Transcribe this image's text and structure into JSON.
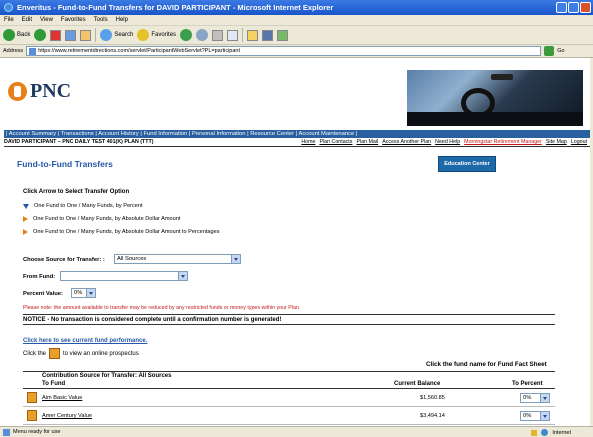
{
  "window": {
    "title": "Enveritus - Fund-to-Fund Transfers for DAVID PARTICIPANT - Microsoft Internet Explorer"
  },
  "menu": [
    "File",
    "Edit",
    "View",
    "Favorites",
    "Tools",
    "Help"
  ],
  "toolbar": {
    "back": "Back",
    "search": "Search",
    "favorites": "Favorites"
  },
  "address": {
    "label": "Address",
    "url": "https://www.retirementdirections.com/servlet/ParticipantWebServlet?PL=participant",
    "go": "Go"
  },
  "brand": {
    "name": "PNC"
  },
  "nav": {
    "text": "| Account Summary | Transactions | Account History | Fund Information | Personal Information | Resource Center | Account Maintenance |"
  },
  "subbar": {
    "user": "DAVID PARTICIPANT – PNC DAILY TEST 401(K) PLAN (TTT)",
    "links": [
      "Home",
      "Plan Contacts",
      "Plan Mail",
      "Access Another Plan",
      "Need Help",
      "Morningstar Retirement Manager",
      "Site Map",
      "Logout"
    ]
  },
  "main": {
    "title": "Fund-to-Fund Transfers",
    "education_button": "Education Center",
    "options_heading": "Click Arrow to Select Transfer Option",
    "options": [
      "One Fund to One / Many Funds, by Percent",
      "One Fund to One / Many Funds, by Absolute Dollar Amount",
      "One Fund to One / Many Funds, by Absolute Dollar Amount to Percentages"
    ],
    "source_label": "Choose Source for Transfer: :",
    "source_value": "All Sources",
    "from_fund_label": "From Fund:",
    "from_fund_value": "",
    "percent_label": "Percent Value:",
    "percent_value": "0%",
    "note": "Please note: the amount available to transfer may be reduced by any restricted funds or money types within your Plan.",
    "notice": "NOTICE - No transaction is considered complete until a confirmation number is generated!",
    "perf_link": "Click here to see current fund performance.",
    "prospectus_before": "Click the",
    "prospectus_after": "to view an online prospectus",
    "fund_hint": "Click the fund name for Fund Fact Sheet"
  },
  "table": {
    "caption": "Contribution Source for Transfer: All Sources",
    "headers": {
      "fund": "To Fund",
      "balance": "Current Balance",
      "percent": "To Percent"
    },
    "rows": [
      {
        "fund": "Aim Basic Value",
        "balance": "$1,560.85",
        "percent": "0%"
      },
      {
        "fund": "Amer Century Value",
        "balance": "$3,494.14",
        "percent": "0%"
      }
    ]
  },
  "status": {
    "text": "Menu ready for use",
    "zone": "Internet"
  }
}
